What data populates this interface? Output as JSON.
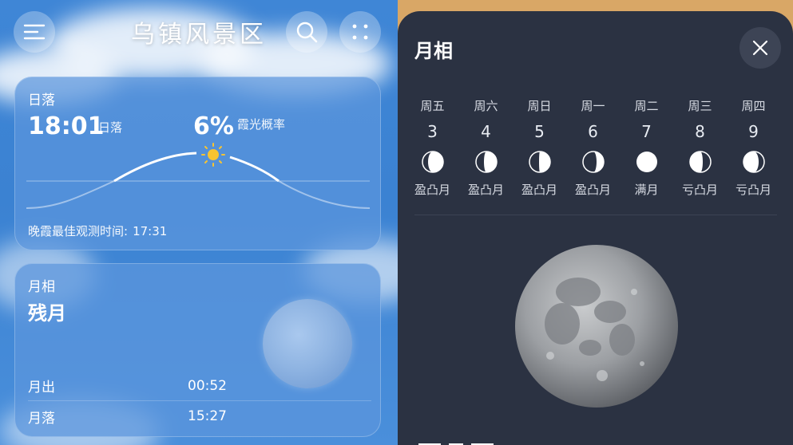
{
  "header": {
    "city": "乌镇风景区"
  },
  "sunset_card": {
    "title": "日落",
    "time": "18:01",
    "time_unit": "日落",
    "probability": "6%",
    "probability_label": "霞光概率",
    "best_time_label": "晚霞最佳观测时间:",
    "best_time_value": "17:31"
  },
  "moon_card": {
    "title": "月相",
    "phase_name": "残月",
    "moonrise_label": "月出",
    "moonrise_value": "00:52",
    "moonset_label": "月落",
    "moonset_value": "15:27"
  },
  "moon_sheet": {
    "title": "月相",
    "days": [
      {
        "weekday": "周五",
        "date": "3",
        "phase": "盈凸月"
      },
      {
        "weekday": "周六",
        "date": "4",
        "phase": "盈凸月"
      },
      {
        "weekday": "周日",
        "date": "5",
        "phase": "盈凸月"
      },
      {
        "weekday": "周一",
        "date": "6",
        "phase": "盈凸月"
      },
      {
        "weekday": "周二",
        "date": "7",
        "phase": "满月"
      },
      {
        "weekday": "周三",
        "date": "8",
        "phase": "亏凸月"
      },
      {
        "weekday": "周四",
        "date": "9",
        "phase": "亏凸月"
      }
    ]
  },
  "icons": {
    "menu": "menu-icon",
    "search": "search-icon",
    "more": "more-dots-icon",
    "close": "close-icon",
    "sun": "sun-icon"
  },
  "colors": {
    "sky_blue": "#3f86d6",
    "sheet_bg": "#2b3242",
    "sun": "#f7c431"
  }
}
